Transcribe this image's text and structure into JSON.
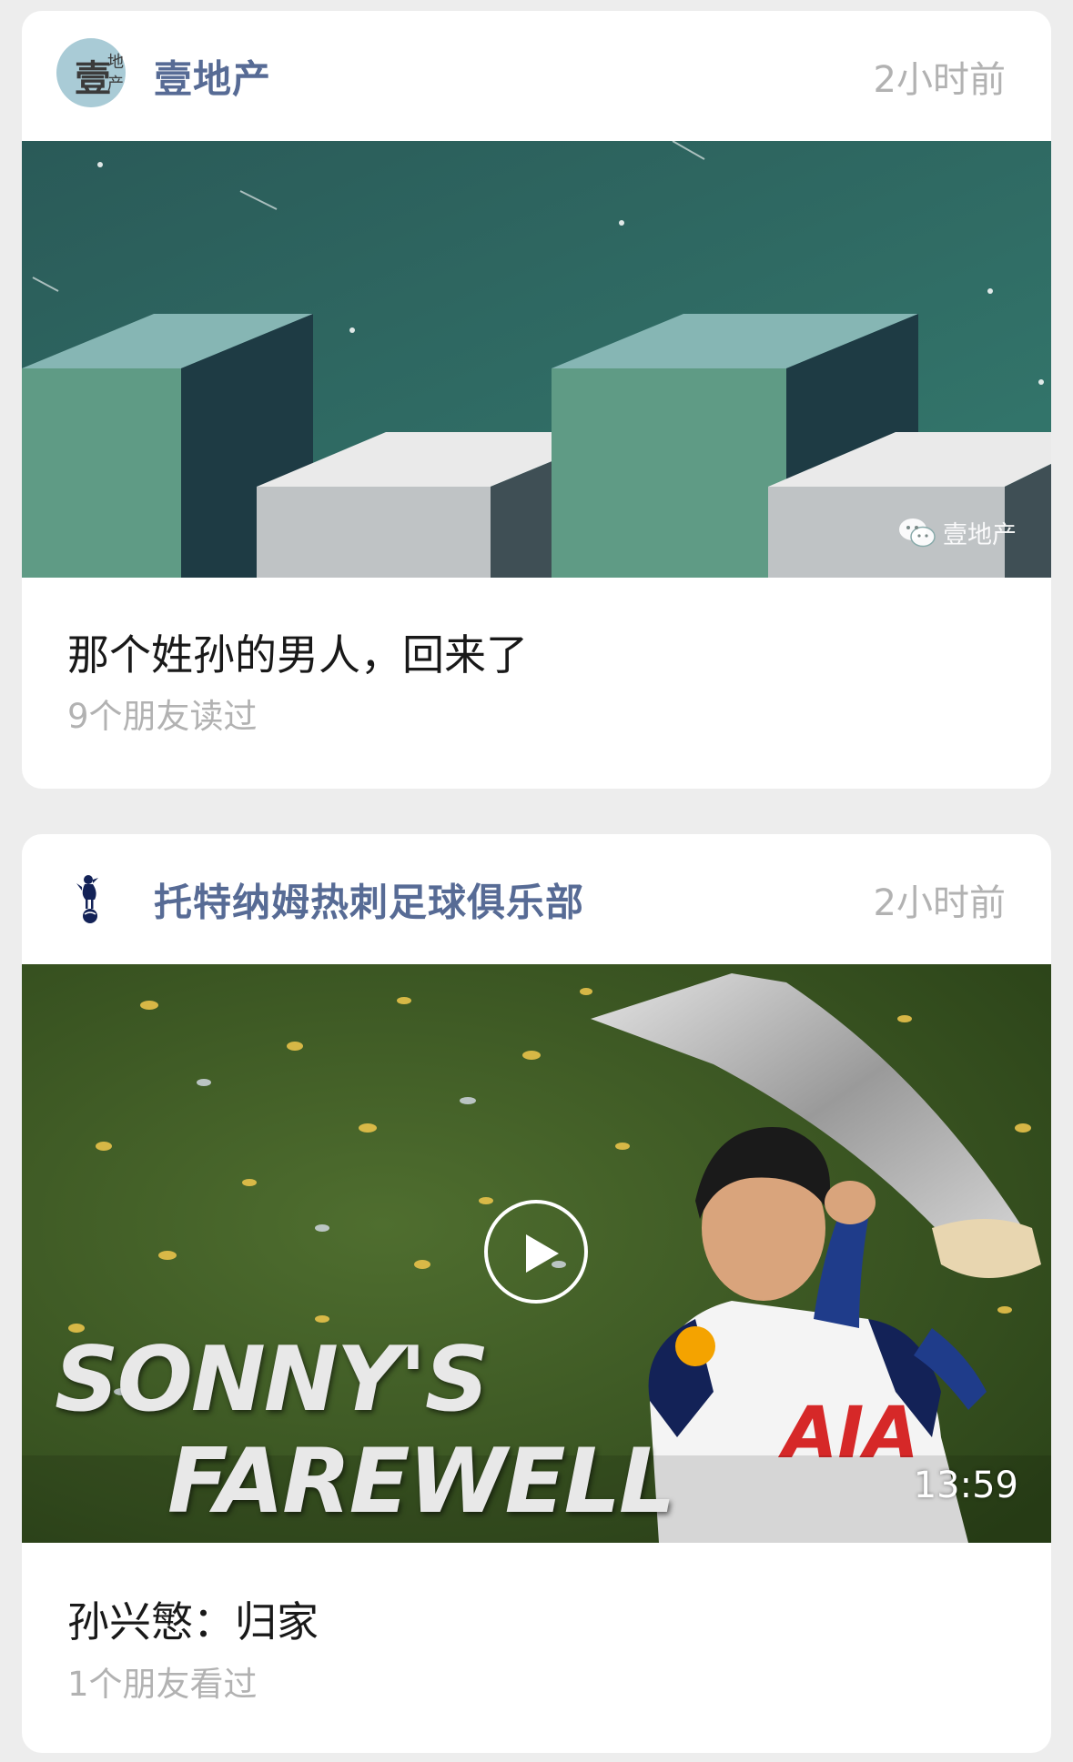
{
  "feed": [
    {
      "account": {
        "name": "壹地产",
        "avatar_text_main": "壹",
        "avatar_text_small_1": "地",
        "avatar_text_small_2": "产"
      },
      "time": "2小时前",
      "cover": {
        "watermark": "壹地产",
        "watermark_icon": "wechat-icon"
      },
      "title": "那个姓孙的男人，回来了",
      "meta": "9个朋友读过"
    },
    {
      "account": {
        "name": "托特纳姆热刺足球俱乐部",
        "avatar_icon": "spurs-cockerel-icon"
      },
      "time": "2小时前",
      "cover": {
        "headline_line1": "SONNY'S",
        "headline_line2": "FAREWELL",
        "sponsor": "AIA",
        "duration": "13:59",
        "play_icon": "play-icon"
      },
      "title": "孙兴慜：归家",
      "meta": "1个朋友看过"
    }
  ],
  "colors": {
    "account_name": "#576b95",
    "time": "#b2b2b2",
    "title": "#191919",
    "meta": "#b2b2b2",
    "background": "#ededed"
  }
}
